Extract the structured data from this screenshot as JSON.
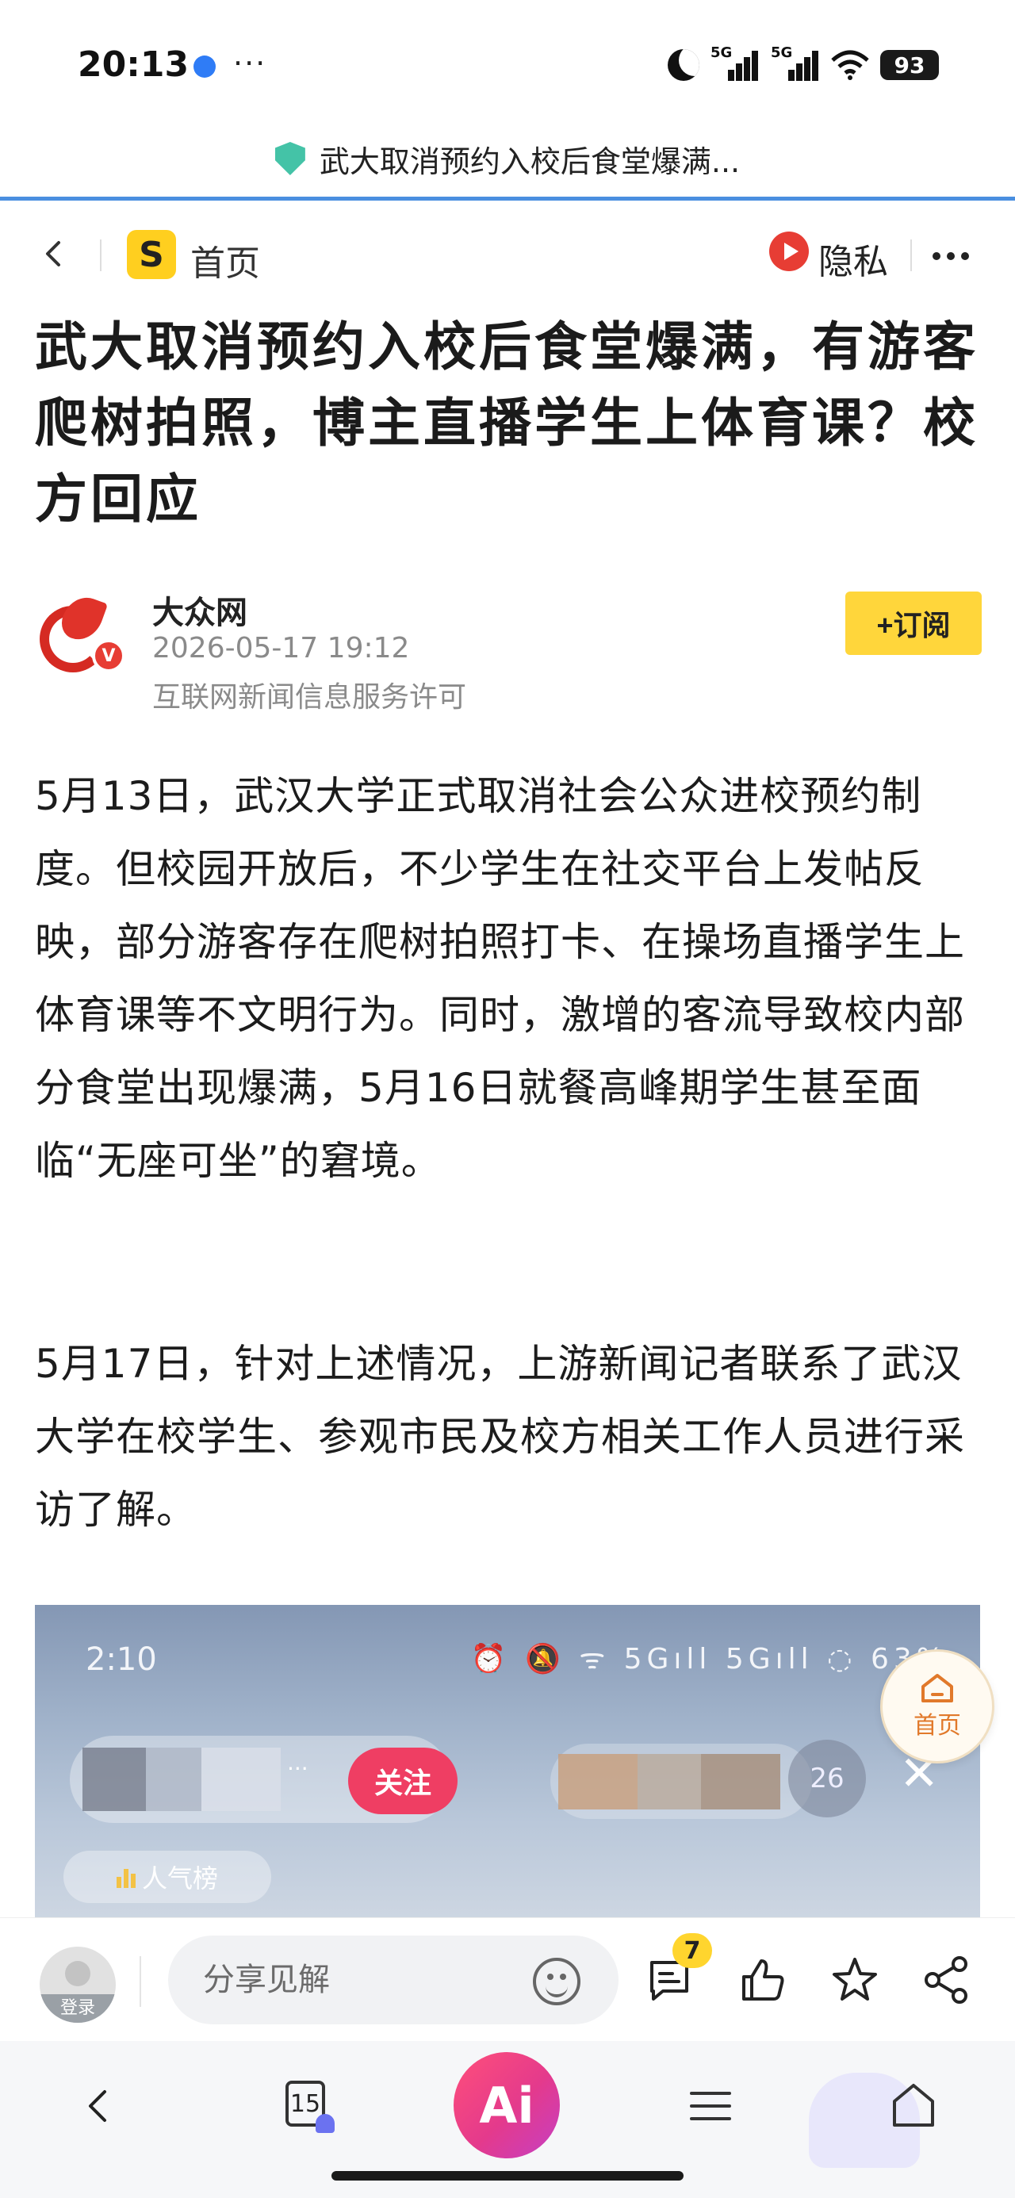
{
  "status_bar": {
    "time": "20:13",
    "more": "···",
    "network_1": "5G",
    "network_2": "5G",
    "battery": "93"
  },
  "url_bar": {
    "title": "武大取消预约入校后食堂爆满..."
  },
  "article_header": {
    "home_label": "首页",
    "privacy_label": "隐私",
    "brand_logo": "S"
  },
  "article": {
    "title": "武大取消预约入校后食堂爆满，有游客爬树拍照，博主直播学生上体育课？校方回应",
    "author": {
      "name": "大众网",
      "time": "2026-05-17 19:12",
      "license": "互联网新闻信息服务许可",
      "verified_mark": "V",
      "subscribe_label": "+订阅"
    },
    "paragraphs": [
      "5月13日，武汉大学正式取消社会公众进校预约制度。但校园开放后，不少学生在社交平台上发帖反映，部分游客存在爬树拍照打卡、在操场直播学生上体育课等不文明行为。同时，激增的客流导致校内部分食堂出现爆满，5月16日就餐高峰期学生甚至面临“无座可坐”的窘境。",
      "5月17日，针对上述情况，上游新闻记者联系了武汉大学在校学生、参观市民及校方相关工作人员进行采访了解。"
    ],
    "embedded_image": {
      "time": "2:10",
      "status": "⏰ 🔕 ᯤ 5Gıll 5Gıll ◌ 63%",
      "follow_label": "关注",
      "ellipsis": "...",
      "viewer_count": "26",
      "close": "✕",
      "rank_label": "人气榜"
    }
  },
  "floating_home": {
    "label": "首页"
  },
  "comment_bar": {
    "login_label": "登录",
    "placeholder": "分享见解",
    "comment_count": "7"
  },
  "nav_bar": {
    "tabs_count": "15",
    "ai_label": "Ai"
  },
  "colors": {
    "accent_yellow": "#ffd63b",
    "brand_red": "#e73d34",
    "url_progress": "#4a8fe0",
    "ai_gradient_start": "#ff4f7a",
    "ai_gradient_end": "#c53fc4"
  }
}
